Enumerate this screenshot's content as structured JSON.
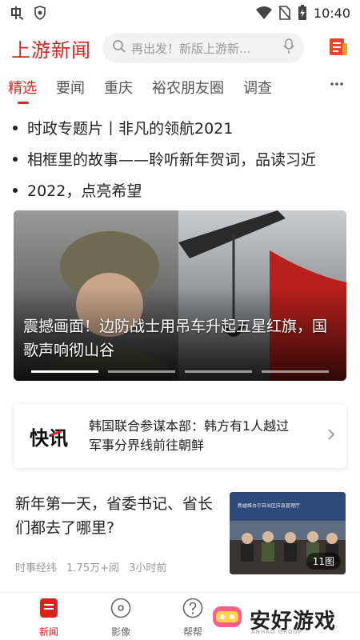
{
  "status_bar": {
    "time": "10:40",
    "icons": [
      "app-notification-icon",
      "shield-icon",
      "wifi-icon",
      "no-sim-icon",
      "battery-icon"
    ]
  },
  "header": {
    "brand": "上游新闻",
    "search_placeholder": "再出发！新版上游新...",
    "icons": [
      "search-icon",
      "microphone-icon",
      "newspaper-icon"
    ]
  },
  "tabs": [
    {
      "label": "精选",
      "active": true
    },
    {
      "label": "要闻",
      "active": false
    },
    {
      "label": "重庆",
      "active": false
    },
    {
      "label": "裕农朋友圈",
      "active": false
    },
    {
      "label": "调查",
      "active": false
    }
  ],
  "headlines": [
    "时政专题片丨非凡的领航2021",
    "相框里的故事——聆听新年贺词，品读习近",
    "2022，点亮希望"
  ],
  "hero": {
    "title": "震撼画面！边防战士用吊车升起五星红旗，国歌声响彻山谷",
    "slide_count": 4,
    "active_slide": 0
  },
  "flash": {
    "logo": "快讯",
    "text": "韩国联合参谋本部：韩方有1人越过军事分界线前往朝鲜"
  },
  "article": {
    "title": "新年第一天，省委书记、省长们都去了哪里?",
    "source": "时事经纬",
    "reads": "1.75万+阅",
    "time": "3小时前",
    "image_count": "11图",
    "thumb_sign": "新疆维吾尔自治区应急管理厅"
  },
  "bottom_nav": [
    {
      "label": "新闻",
      "icon": "news-icon",
      "active": true
    },
    {
      "label": "影像",
      "icon": "video-icon",
      "active": false
    },
    {
      "label": "帮帮",
      "icon": "help-icon",
      "active": false
    }
  ],
  "watermark": {
    "text": "安好游戏",
    "sub": "ANHAO GROUP"
  },
  "colors": {
    "accent": "#d9231f",
    "text": "#222222",
    "muted": "#999999"
  }
}
